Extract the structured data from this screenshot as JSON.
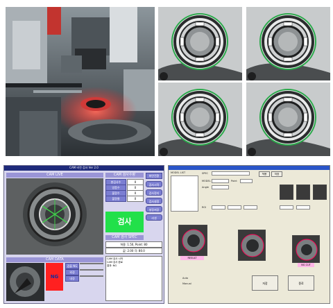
{
  "photo": {
    "description_icon": "machine-photo"
  },
  "grid": {
    "cells": 4
  },
  "app1": {
    "title": "CAM 비전 검사 Ver 2.0",
    "top_right_btn": "화면전환",
    "cam_live": "CAM LIVE",
    "cam_result_title": "CAM 검사수량",
    "counters": [
      {
        "label": "총검사수",
        "value": "0"
      },
      {
        "label": "양품수",
        "value": "0"
      },
      {
        "label": "불량수",
        "value": "0"
      },
      {
        "label": "불량율",
        "value": "0"
      }
    ],
    "side_buttons": [
      "검사시작",
      "검사정지",
      "검사설정",
      "설정저장",
      "리셋"
    ],
    "result_big": "검사",
    "spec_title": "CAM 검사 SPEC",
    "spec_value": "허용: 1.50, Point: 80",
    "spec_value2": "값: 2.00 각: 80.0",
    "cam_data": "CAM DATA",
    "data_rows": [
      "검출 NG",
      "외경",
      "내경"
    ],
    "ng_label": "NG",
    "log_lines": [
      "CAM 검사 시작",
      "CAM 검사 완료",
      "결과: NG"
    ]
  },
  "app2": {
    "left_list_label": "MODEL LIST",
    "inputs": [
      "SPEC",
      "MODEL",
      "Point",
      "Angle"
    ],
    "buttons": [
      "적용",
      "저장",
      "Load",
      "Save"
    ],
    "result_labels": [
      "RESULT",
      "NG CUT"
    ],
    "bottom_buttons": [
      "저장",
      "종료"
    ],
    "check_labels": [
      "Auto",
      "Manual"
    ]
  }
}
